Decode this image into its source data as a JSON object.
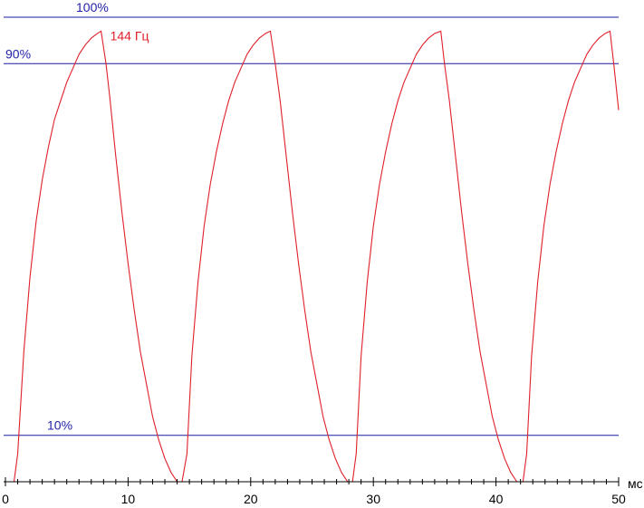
{
  "chart_data": {
    "type": "line",
    "xlabel": "мс",
    "xlim": [
      0,
      50
    ],
    "ylim": [
      0,
      100
    ],
    "x_ticks": [
      0,
      10,
      20,
      30,
      40,
      50
    ],
    "minor_tick_step": 1,
    "reference_lines": [
      {
        "label": "100%",
        "y": 100
      },
      {
        "label": "90%",
        "y": 90
      },
      {
        "label": "10%",
        "y": 10
      }
    ],
    "series": [
      {
        "name": "144 Гц",
        "color": "#e0202a",
        "points": [
          [
            0,
            0
          ],
          [
            0.7,
            0
          ],
          [
            1,
            6
          ],
          [
            1.5,
            28
          ],
          [
            2,
            44
          ],
          [
            2.5,
            56
          ],
          [
            3,
            65
          ],
          [
            3.5,
            72
          ],
          [
            4,
            78
          ],
          [
            4.5,
            82
          ],
          [
            5,
            86
          ],
          [
            5.5,
            89
          ],
          [
            6,
            92
          ],
          [
            6.5,
            94
          ],
          [
            7,
            95.5
          ],
          [
            7.5,
            96.5
          ],
          [
            7.8,
            97
          ],
          [
            8.2,
            90
          ],
          [
            8.5,
            83
          ],
          [
            9,
            70
          ],
          [
            9.5,
            58
          ],
          [
            10,
            47
          ],
          [
            10.5,
            37
          ],
          [
            11,
            28
          ],
          [
            11.5,
            21
          ],
          [
            12,
            14
          ],
          [
            12.5,
            9
          ],
          [
            13,
            5
          ],
          [
            13.5,
            2
          ],
          [
            14,
            0
          ],
          [
            14.4,
            0
          ],
          [
            14.8,
            6
          ],
          [
            15.2,
            27
          ],
          [
            15.7,
            43
          ],
          [
            16.2,
            55
          ],
          [
            16.7,
            64
          ],
          [
            17.2,
            71
          ],
          [
            17.7,
            77
          ],
          [
            18.2,
            82
          ],
          [
            18.7,
            86
          ],
          [
            19.2,
            89
          ],
          [
            19.7,
            92
          ],
          [
            20.2,
            94
          ],
          [
            20.7,
            95.5
          ],
          [
            21.2,
            96.5
          ],
          [
            21.6,
            97
          ],
          [
            22,
            90
          ],
          [
            22.4,
            82
          ],
          [
            22.9,
            70
          ],
          [
            23.4,
            58
          ],
          [
            23.9,
            47
          ],
          [
            24.4,
            37
          ],
          [
            24.9,
            28
          ],
          [
            25.4,
            21
          ],
          [
            25.9,
            14
          ],
          [
            26.4,
            9
          ],
          [
            26.9,
            5
          ],
          [
            27.4,
            2
          ],
          [
            27.9,
            0
          ],
          [
            28.3,
            0
          ],
          [
            28.6,
            6
          ],
          [
            29,
            27
          ],
          [
            29.5,
            43
          ],
          [
            30,
            55
          ],
          [
            30.5,
            64
          ],
          [
            31,
            71
          ],
          [
            31.5,
            77
          ],
          [
            32,
            82
          ],
          [
            32.5,
            86
          ],
          [
            33,
            89
          ],
          [
            33.5,
            92
          ],
          [
            34,
            94
          ],
          [
            34.5,
            95.5
          ],
          [
            35,
            96.5
          ],
          [
            35.5,
            97
          ],
          [
            35.8,
            90
          ],
          [
            36.2,
            82
          ],
          [
            36.7,
            70
          ],
          [
            37.2,
            58
          ],
          [
            37.7,
            47
          ],
          [
            38.2,
            37
          ],
          [
            38.7,
            28
          ],
          [
            39.2,
            21
          ],
          [
            39.7,
            14
          ],
          [
            40.2,
            9
          ],
          [
            40.7,
            5
          ],
          [
            41.2,
            2
          ],
          [
            41.7,
            0
          ],
          [
            42.2,
            0
          ],
          [
            42.5,
            6
          ],
          [
            42.9,
            27
          ],
          [
            43.4,
            43
          ],
          [
            43.9,
            55
          ],
          [
            44.4,
            64
          ],
          [
            44.9,
            71
          ],
          [
            45.4,
            77
          ],
          [
            45.9,
            82
          ],
          [
            46.4,
            86
          ],
          [
            46.9,
            89
          ],
          [
            47.4,
            92
          ],
          [
            47.9,
            94
          ],
          [
            48.4,
            95.5
          ],
          [
            48.9,
            96.5
          ],
          [
            49.3,
            97
          ],
          [
            49.6,
            90
          ],
          [
            50,
            80
          ]
        ]
      }
    ]
  }
}
